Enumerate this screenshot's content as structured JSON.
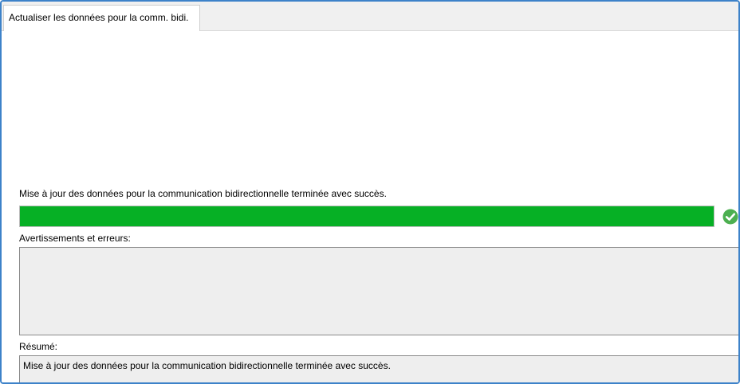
{
  "tabs": [
    {
      "label": "Actualiser les données pour la comm. bidi.",
      "active": true
    }
  ],
  "status": {
    "message": "Mise à jour des données pour la communication bidirectionnelle terminée avec succès.",
    "progress_percent": 100,
    "progress_color": "#06b025",
    "state_icon": "check-circle-icon",
    "state_color": "#4caf50"
  },
  "warnings": {
    "label": "Avertissements et erreurs:",
    "text": ""
  },
  "summary": {
    "label": "Résumé:",
    "text": "Mise à jour des données pour la communication bidirectionnelle terminée avec succès."
  }
}
